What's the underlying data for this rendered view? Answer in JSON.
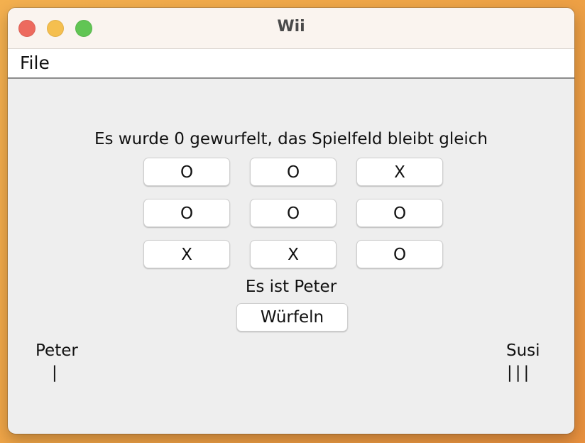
{
  "window": {
    "title": "Wii"
  },
  "menubar": {
    "items": [
      {
        "label": "File"
      }
    ]
  },
  "game": {
    "status": "Es wurde 0 gewurfelt, das Spielfeld bleibt gleich",
    "board": [
      [
        "O",
        "O",
        "X"
      ],
      [
        "O",
        "O",
        "O"
      ],
      [
        "X",
        "X",
        "O"
      ]
    ],
    "turn_text": "Es ist Peter",
    "dice_button": "Würfeln"
  },
  "players": [
    {
      "name": "Peter",
      "score": "|"
    },
    {
      "name": "Susi",
      "score": "|||"
    }
  ],
  "colors": {
    "close": "#ed6a5e",
    "minimize": "#f5bf4f",
    "maximize": "#61c554"
  }
}
